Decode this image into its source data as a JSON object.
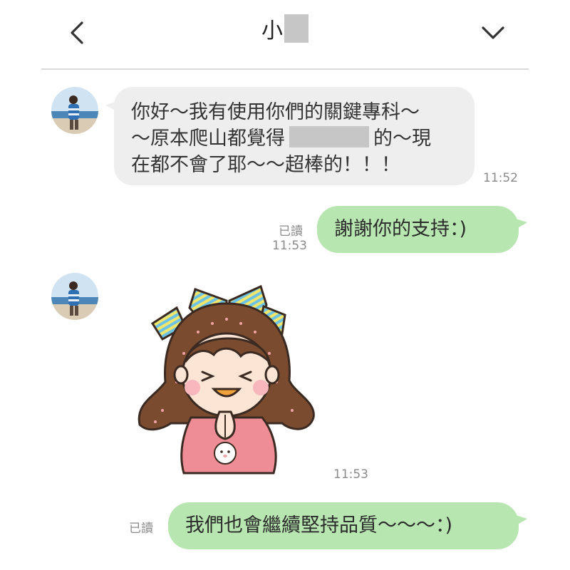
{
  "header": {
    "title": "小",
    "back_icon": "chevron-left-icon",
    "more_icon": "chevron-down-icon"
  },
  "messages": [
    {
      "direction": "incoming",
      "avatar": "user-avatar-photo",
      "line1": "你好～我有使用你們的關鍵專科～",
      "line2_before": "～原本爬山都覺得",
      "line2_after": "的～現",
      "line3": "在都不會了耶～～超棒的！！！",
      "time": "11:52"
    },
    {
      "direction": "outgoing",
      "text": "謝謝你的支持：)",
      "read": "已讀",
      "time": "11:53"
    },
    {
      "direction": "incoming",
      "avatar": "user-avatar-photo",
      "sticker": "girl-thank-you-sticker",
      "time": "11:53"
    },
    {
      "direction": "outgoing",
      "text": "我們也會繼續堅持品質～～～：)",
      "read": "已讀"
    }
  ],
  "colors": {
    "incoming_bubble": "#eeeeee",
    "outgoing_bubble": "#b8e6b0",
    "meta_text": "#8a8a8a",
    "redaction": "#c6c6c6"
  }
}
